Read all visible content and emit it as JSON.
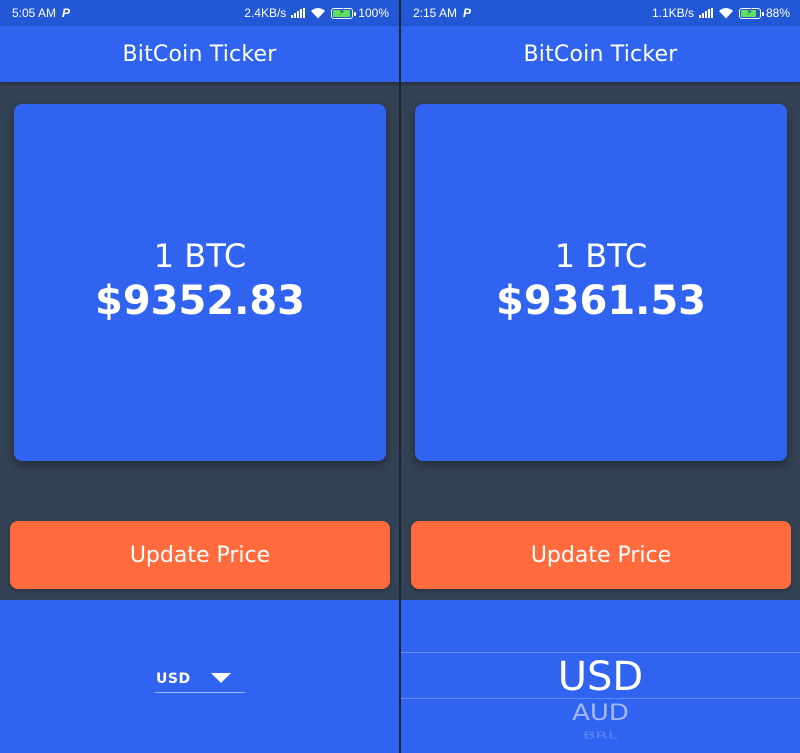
{
  "left_screen": {
    "status_bar": {
      "time": "5:05 AM",
      "p_icon": "P",
      "net_speed": "2.4KB/s",
      "battery": "100%",
      "battery_level": 1.0
    },
    "app_bar": {
      "title": "BitCoin Ticker"
    },
    "price_card": {
      "label": "1 BTC",
      "price": "$9352.83"
    },
    "update_button": {
      "label": "Update Price"
    },
    "currency_dropdown": {
      "selected": "USD"
    }
  },
  "right_screen": {
    "status_bar": {
      "time": "2:15 AM",
      "p_icon": "P",
      "net_speed": "1.1KB/s",
      "battery": "88%",
      "battery_level": 0.88
    },
    "app_bar": {
      "title": "BitCoin Ticker"
    },
    "price_card": {
      "label": "1 BTC",
      "price": "$9361.53"
    },
    "update_button": {
      "label": "Update Price"
    },
    "currency_picker": {
      "selected": "USD",
      "visible_options": [
        "USD",
        "AUD",
        "BRL"
      ]
    }
  },
  "colors": {
    "status_bar": "#2258d6",
    "app_bar": "#2f63f0",
    "background": "#344255",
    "card": "#2f63f0",
    "button": "#ff6b3d",
    "text": "#ffffff",
    "battery_fill": "#5fe05f"
  },
  "icons": [
    "p-icon",
    "signal-icon",
    "wifi-icon",
    "battery-icon",
    "dropdown-arrow-icon"
  ]
}
